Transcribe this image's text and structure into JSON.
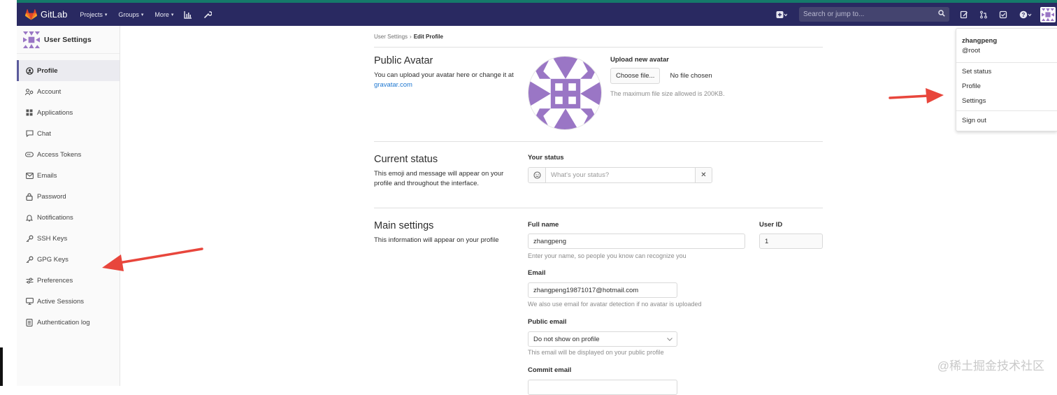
{
  "app": {
    "name": "GitLab"
  },
  "navbar": {
    "items": [
      {
        "label": "Projects"
      },
      {
        "label": "Groups"
      },
      {
        "label": "More"
      }
    ],
    "search_placeholder": "Search or jump to..."
  },
  "sidebar": {
    "title": "User Settings",
    "items": [
      {
        "label": "Profile",
        "icon": "profile-icon"
      },
      {
        "label": "Account",
        "icon": "account-icon"
      },
      {
        "label": "Applications",
        "icon": "applications-icon"
      },
      {
        "label": "Chat",
        "icon": "chat-icon"
      },
      {
        "label": "Access Tokens",
        "icon": "token-icon"
      },
      {
        "label": "Emails",
        "icon": "email-icon"
      },
      {
        "label": "Password",
        "icon": "lock-icon"
      },
      {
        "label": "Notifications",
        "icon": "bell-icon"
      },
      {
        "label": "SSH Keys",
        "icon": "key-icon"
      },
      {
        "label": "GPG Keys",
        "icon": "key-icon"
      },
      {
        "label": "Preferences",
        "icon": "preferences-icon"
      },
      {
        "label": "Active Sessions",
        "icon": "monitor-icon"
      },
      {
        "label": "Authentication log",
        "icon": "log-icon"
      }
    ]
  },
  "breadcrumb": {
    "parent": "User Settings",
    "separator": "›",
    "current": "Edit Profile"
  },
  "avatar_section": {
    "title": "Public Avatar",
    "desc": "You can upload your avatar here or change it at",
    "link": "gravatar.com",
    "upload_label": "Upload new avatar",
    "choose_button": "Choose file...",
    "no_file": "No file chosen",
    "max_size_help": "The maximum file size allowed is 200KB."
  },
  "status_section": {
    "title": "Current status",
    "desc": "This emoji and message will appear on your profile and throughout the interface.",
    "label": "Your status",
    "placeholder": "What's your status?",
    "clear_icon": "✕"
  },
  "main_section": {
    "title": "Main settings",
    "desc": "This information will appear on your profile",
    "full_name_label": "Full name",
    "full_name_value": "zhangpeng",
    "full_name_help": "Enter your name, so people you know can recognize you",
    "user_id_label": "User ID",
    "user_id_value": "1",
    "email_label": "Email",
    "email_value": "zhangpeng19871017@hotmail.com",
    "email_help": "We also use email for avatar detection if no avatar is uploaded",
    "public_email_label": "Public email",
    "public_email_value": "Do not show on profile",
    "public_email_help": "This email will be displayed on your public profile",
    "commit_email_label": "Commit email"
  },
  "user_dropdown": {
    "name": "zhangpeng",
    "handle": "@root",
    "items": [
      "Set status",
      "Profile",
      "Settings",
      "Sign out"
    ]
  },
  "watermark": "@稀土掘金技术社区",
  "colors": {
    "navbar": "#292961",
    "accent_link": "#1f78d1",
    "avatar_purple": "#9a76c5",
    "arrow_red": "#e8463c"
  }
}
